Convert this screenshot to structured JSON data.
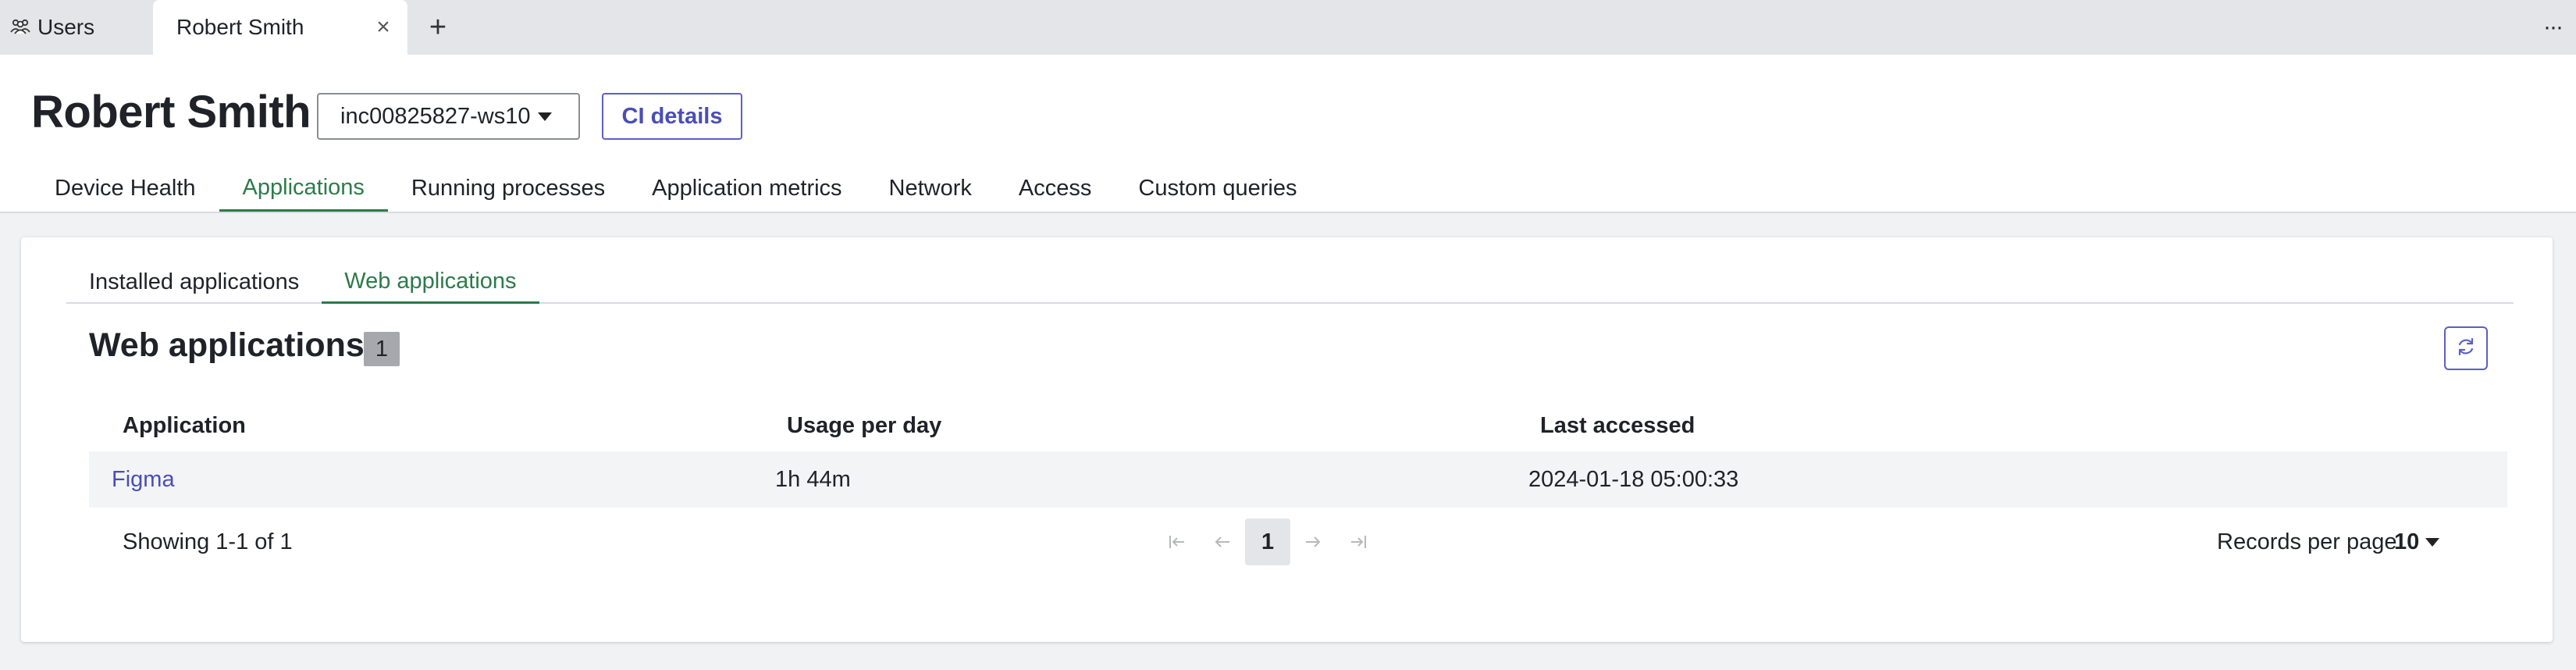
{
  "tabstrip": {
    "tabs": [
      {
        "label": "Users",
        "icon": "users-icon"
      },
      {
        "label": "Robert Smith",
        "icon": "close-icon"
      }
    ],
    "add_icon": "plus-icon",
    "more_icon": "more-horizontal-icon"
  },
  "header": {
    "title": "Robert Smith",
    "device": "inc00825827-ws10",
    "ci_details_label": "CI details"
  },
  "main_tabs": [
    {
      "label": "Device Health",
      "active": false
    },
    {
      "label": "Applications",
      "active": true
    },
    {
      "label": "Running processes",
      "active": false
    },
    {
      "label": "Application metrics",
      "active": false
    },
    {
      "label": "Network",
      "active": false
    },
    {
      "label": "Access",
      "active": false
    },
    {
      "label": "Custom queries",
      "active": false
    }
  ],
  "sub_tabs": [
    {
      "label": "Installed applications",
      "active": false
    },
    {
      "label": "Web applications",
      "active": true
    }
  ],
  "section": {
    "title": "Web applications",
    "count": "1",
    "refresh_icon": "refresh-icon"
  },
  "table": {
    "columns": [
      "Application",
      "Usage per day",
      "Last accessed"
    ],
    "rows": [
      [
        "Figma",
        "1h 44m",
        "2024-01-18 05:00:33"
      ]
    ]
  },
  "footer": {
    "showing": "Showing 1-1 of 1",
    "current_page": "1",
    "records_per_page_label": "Records per page",
    "records_per_page_value": "10"
  },
  "colors": {
    "accent_green": "#2d7a4b",
    "link_blue": "#4a4db8",
    "tabstrip_bg": "#e4e5e8"
  }
}
